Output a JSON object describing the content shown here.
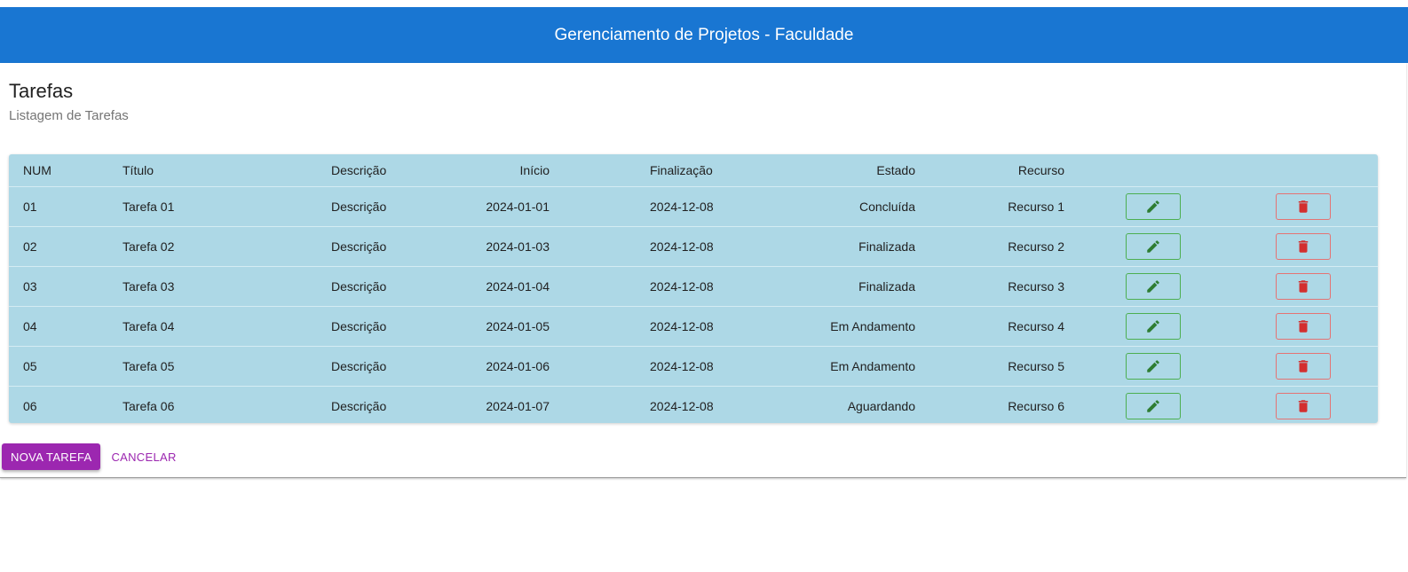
{
  "app": {
    "title": "Gerenciamento de Projetos - Faculdade"
  },
  "card": {
    "title": "Tarefas",
    "subtitle": "Listagem de Tarefas"
  },
  "table": {
    "headers": {
      "num": "NUM",
      "title": "Título",
      "description": "Descrição",
      "start": "Início",
      "end": "Finalização",
      "status": "Estado",
      "resource": "Recurso"
    },
    "rows": [
      {
        "num": "01",
        "title": "Tarefa 01",
        "description": "Descrição",
        "start": "2024-01-01",
        "end": "2024-12-08",
        "status": "Concluída",
        "resource": "Recurso 1"
      },
      {
        "num": "02",
        "title": "Tarefa 02",
        "description": "Descrição",
        "start": "2024-01-03",
        "end": "2024-12-08",
        "status": "Finalizada",
        "resource": "Recurso 2"
      },
      {
        "num": "03",
        "title": "Tarefa 03",
        "description": "Descrição",
        "start": "2024-01-04",
        "end": "2024-12-08",
        "status": "Finalizada",
        "resource": "Recurso 3"
      },
      {
        "num": "04",
        "title": "Tarefa 04",
        "description": "Descrição",
        "start": "2024-01-05",
        "end": "2024-12-08",
        "status": "Em Andamento",
        "resource": "Recurso 4"
      },
      {
        "num": "05",
        "title": "Tarefa 05",
        "description": "Descrição",
        "start": "2024-01-06",
        "end": "2024-12-08",
        "status": "Em Andamento",
        "resource": "Recurso 5"
      },
      {
        "num": "06",
        "title": "Tarefa 06",
        "description": "Descrição",
        "start": "2024-01-07",
        "end": "2024-12-08",
        "status": "Aguardando",
        "resource": "Recurso 6"
      }
    ],
    "edit_icon": "pencil-icon",
    "delete_icon": "trash-icon"
  },
  "actions": {
    "new_label": "NOVA TAREFA",
    "cancel_label": "CANCELAR"
  },
  "colors": {
    "app_bar": "#1976d2",
    "table_bg": "#add8e6",
    "primary": "#9c27b0",
    "edit": "#2e7d32",
    "delete": "#d32f2f"
  }
}
